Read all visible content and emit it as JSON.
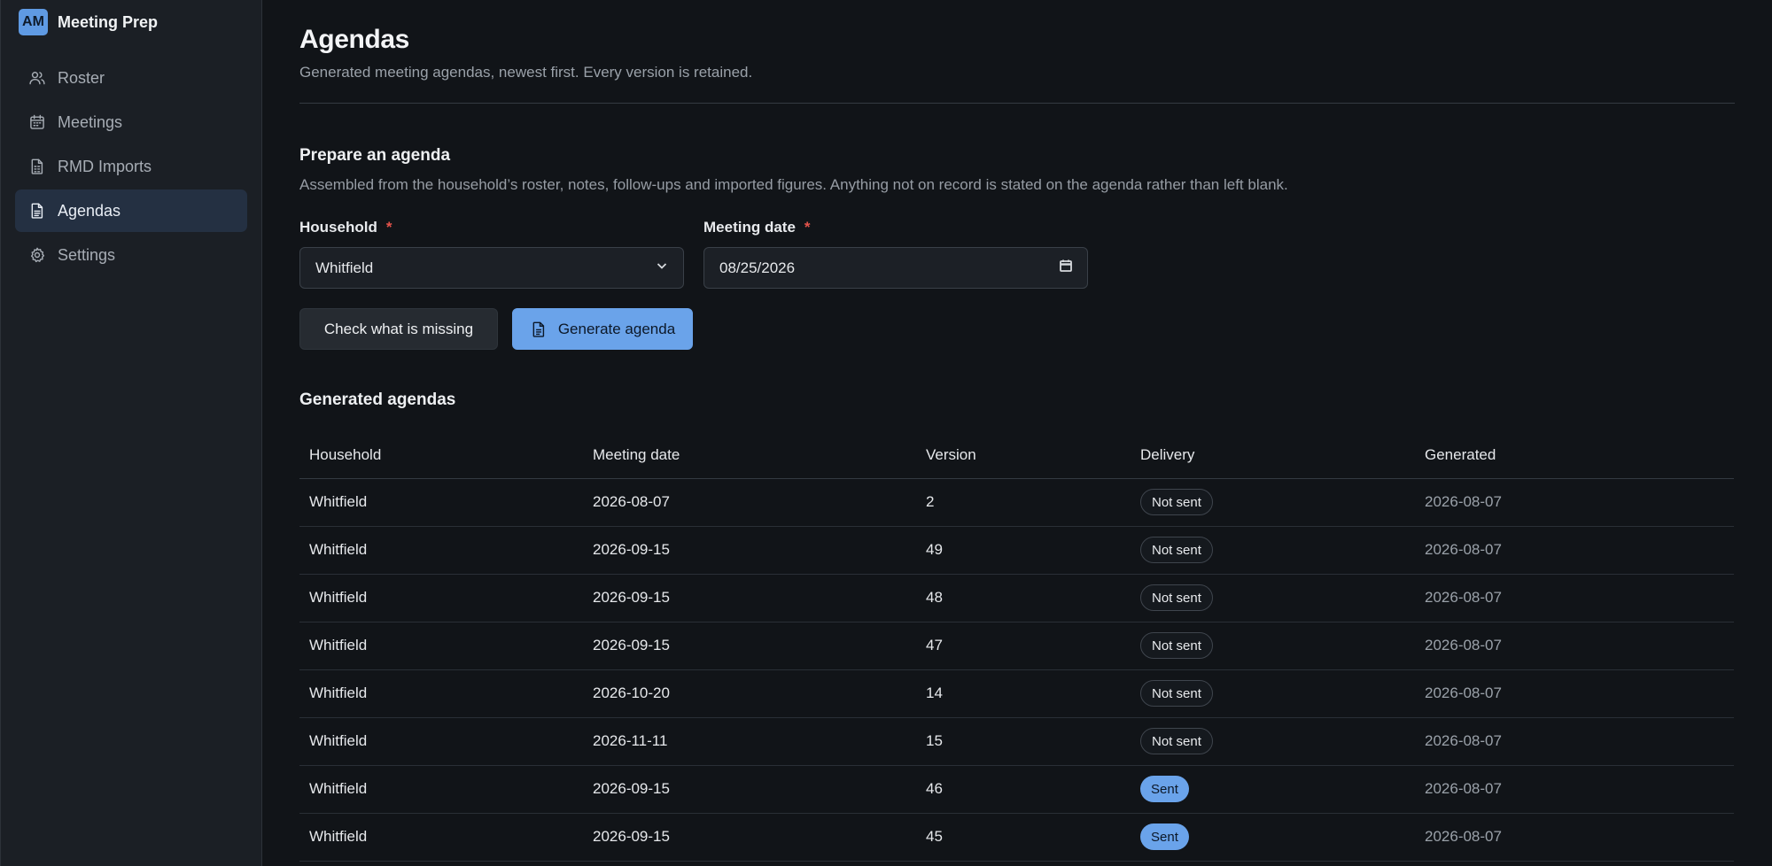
{
  "app": {
    "avatar_initials": "AM",
    "name": "Meeting Prep"
  },
  "sidebar": {
    "items": [
      {
        "label": "Roster",
        "icon": "users-icon",
        "active": false
      },
      {
        "label": "Meetings",
        "icon": "calendar-icon",
        "active": false
      },
      {
        "label": "RMD Imports",
        "icon": "spreadsheet-icon",
        "active": false
      },
      {
        "label": "Agendas",
        "icon": "document-icon",
        "active": true
      },
      {
        "label": "Settings",
        "icon": "gear-icon",
        "active": false
      }
    ]
  },
  "page": {
    "title": "Agendas",
    "subtitle": "Generated meeting agendas, newest first. Every version is retained."
  },
  "prepare": {
    "title": "Prepare an agenda",
    "description": "Assembled from the household’s roster, notes, follow-ups and imported figures. Anything not on record is stated on the agenda rather than left blank.",
    "household_label": "Household",
    "household_value": "Whitfield",
    "date_label": "Meeting date",
    "date_value": "08/25/2026",
    "required_mark": "*",
    "check_button": "Check what is missing",
    "generate_button": "Generate agenda"
  },
  "agendas": {
    "title": "Generated agendas",
    "columns": [
      "Household",
      "Meeting date",
      "Version",
      "Delivery",
      "Generated"
    ],
    "rows": [
      {
        "household": "Whitfield",
        "meeting_date": "2026-08-07",
        "version": "2",
        "delivery": "Not sent",
        "generated": "2026-08-07"
      },
      {
        "household": "Whitfield",
        "meeting_date": "2026-09-15",
        "version": "49",
        "delivery": "Not sent",
        "generated": "2026-08-07"
      },
      {
        "household": "Whitfield",
        "meeting_date": "2026-09-15",
        "version": "48",
        "delivery": "Not sent",
        "generated": "2026-08-07"
      },
      {
        "household": "Whitfield",
        "meeting_date": "2026-09-15",
        "version": "47",
        "delivery": "Not sent",
        "generated": "2026-08-07"
      },
      {
        "household": "Whitfield",
        "meeting_date": "2026-10-20",
        "version": "14",
        "delivery": "Not sent",
        "generated": "2026-08-07"
      },
      {
        "household": "Whitfield",
        "meeting_date": "2026-11-11",
        "version": "15",
        "delivery": "Not sent",
        "generated": "2026-08-07"
      },
      {
        "household": "Whitfield",
        "meeting_date": "2026-09-15",
        "version": "46",
        "delivery": "Sent",
        "generated": "2026-08-07"
      },
      {
        "household": "Whitfield",
        "meeting_date": "2026-09-15",
        "version": "45",
        "delivery": "Sent",
        "generated": "2026-08-07"
      }
    ]
  },
  "colors": {
    "accent": "#6aa3ea",
    "background": "#111418",
    "sidebar": "#1b1f25",
    "required": "#e5534b"
  }
}
